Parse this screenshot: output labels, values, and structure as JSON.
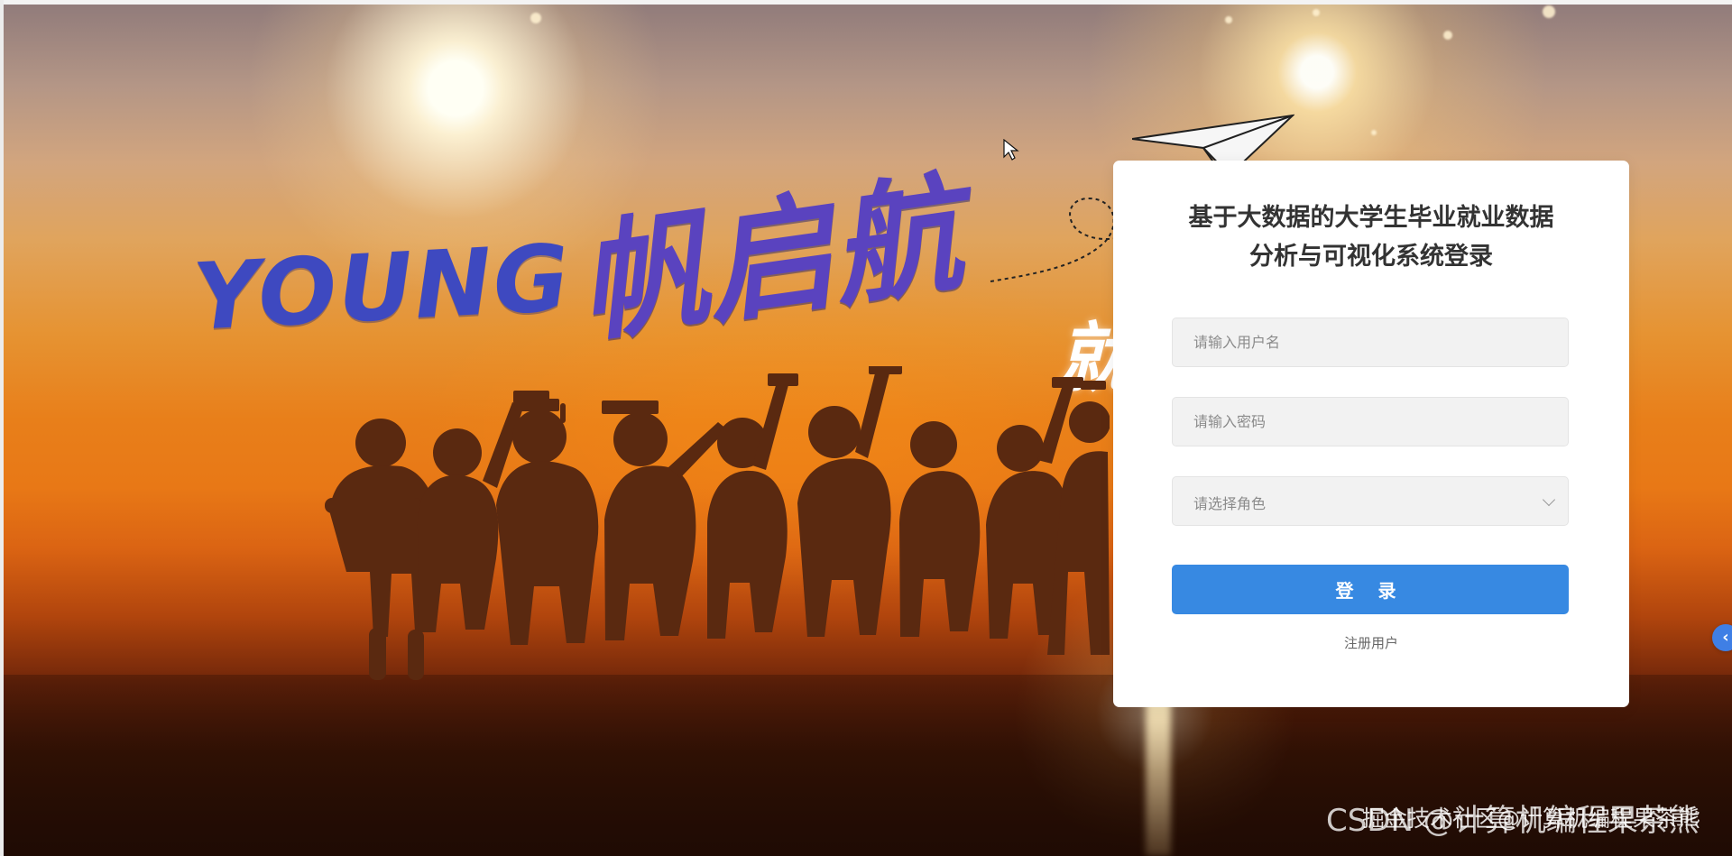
{
  "hero": {
    "banner_title": "YOUNG",
    "banner_subtitle": "帆启航",
    "banner_side_text": "就"
  },
  "login": {
    "title_line_1": "基于大数据的大学生毕业就业数据",
    "title_line_2": "分析与可视化系统登录",
    "username_placeholder": "请输入用户名",
    "password_placeholder": "请输入密码",
    "role_placeholder": "请选择角色",
    "login_button": "登 录",
    "register_link": "注册用户"
  },
  "floating": {
    "toggle_icon": "chevron-left-icon",
    "toggle_symbol": "‹"
  },
  "watermark": {
    "text": "CSDN @计算机编程果茶熊",
    "overlay": "掘金技术社区@计算机编程果茶熊"
  },
  "colors": {
    "card_background": "#ffffff",
    "primary_button": "#3789e2",
    "title_text": "#333333",
    "toggle_button": "#3f7fe5"
  }
}
